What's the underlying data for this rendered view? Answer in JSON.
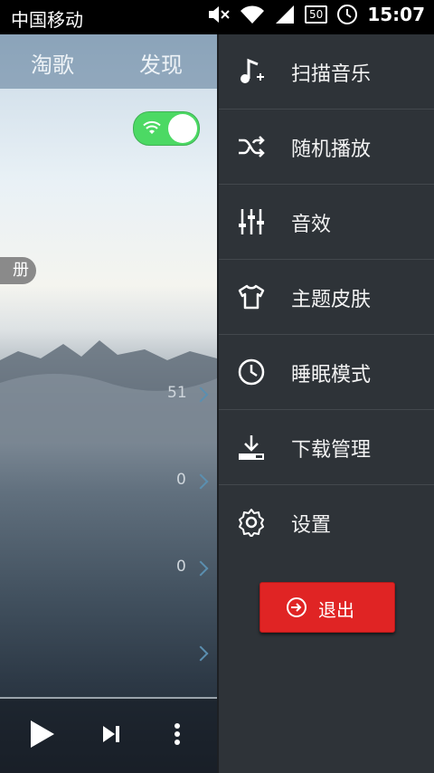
{
  "status_bar": {
    "carrier": "中国移动",
    "battery": "50",
    "time": "15:07"
  },
  "main": {
    "tabs": [
      {
        "label": "淘歌"
      },
      {
        "label": "发现"
      }
    ],
    "pill_text": "册",
    "counts": [
      "51",
      "0",
      "0"
    ]
  },
  "drawer": {
    "items": [
      {
        "label": "扫描音乐",
        "icon": "music-note-plus-icon"
      },
      {
        "label": "随机播放",
        "icon": "shuffle-icon"
      },
      {
        "label": "音效",
        "icon": "equalizer-icon"
      },
      {
        "label": "主题皮肤",
        "icon": "tshirt-icon"
      },
      {
        "label": "睡眠模式",
        "icon": "clock-icon"
      },
      {
        "label": "下载管理",
        "icon": "download-icon"
      },
      {
        "label": "设置",
        "icon": "gear-icon"
      }
    ],
    "exit_label": "退出"
  },
  "colors": {
    "drawer_bg": "#2e3338",
    "exit_red": "#e02424",
    "toggle_green": "#4cd964"
  }
}
